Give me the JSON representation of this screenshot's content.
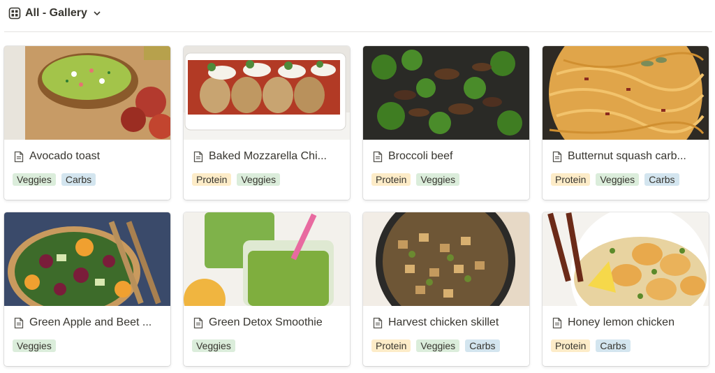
{
  "view": {
    "title": "All - Gallery",
    "icon": "gallery-view-icon"
  },
  "tag_colors": {
    "Veggies": "#dbeddb",
    "Carbs": "#d3e5ef",
    "Protein": "#fdecc8"
  },
  "cards": [
    {
      "title": "Avocado toast",
      "tags": [
        "Veggies",
        "Carbs"
      ]
    },
    {
      "title": "Baked Mozzarella Chi...",
      "tags": [
        "Protein",
        "Veggies"
      ]
    },
    {
      "title": "Broccoli beef",
      "tags": [
        "Protein",
        "Veggies"
      ]
    },
    {
      "title": "Butternut squash carb...",
      "tags": [
        "Protein",
        "Veggies",
        "Carbs"
      ]
    },
    {
      "title": "Green Apple and Beet ...",
      "tags": [
        "Veggies"
      ]
    },
    {
      "title": "Green Detox Smoothie",
      "tags": [
        "Veggies"
      ]
    },
    {
      "title": "Harvest chicken skillet",
      "tags": [
        "Protein",
        "Veggies",
        "Carbs"
      ]
    },
    {
      "title": "Honey lemon chicken",
      "tags": [
        "Protein",
        "Carbs"
      ]
    }
  ]
}
